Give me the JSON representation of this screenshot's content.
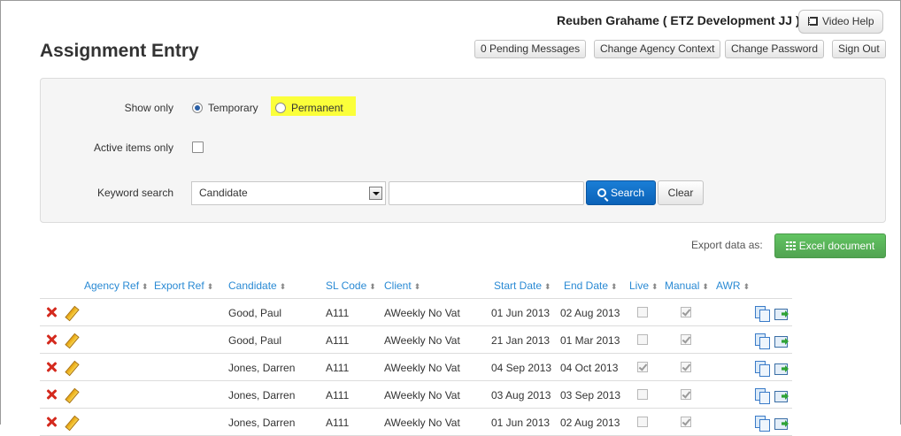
{
  "header": {
    "user_name": "Reuben Grahame ( ETZ Development JJ )",
    "video_help": "Video Help",
    "page_title": "Assignment Entry",
    "links": [
      "0 Pending Messages",
      "Change Agency Context",
      "Change Password",
      "Sign Out"
    ]
  },
  "filters": {
    "show_only_label": "Show only",
    "temporary_label": "Temporary",
    "permanent_label": "Permanent",
    "selected": "Temporary",
    "active_label": "Active items only",
    "active_checked": false,
    "keyword_label": "Keyword search",
    "keyword_field": "Candidate",
    "keyword_value": "",
    "search_label": "Search",
    "clear_label": "Clear"
  },
  "export": {
    "label": "Export data as:",
    "excel_label": "Excel document"
  },
  "table": {
    "columns": [
      "Agency Ref",
      "Export Ref",
      "Candidate",
      "SL Code",
      "Client",
      "Start Date",
      "End Date",
      "Live",
      "Manual",
      "AWR"
    ],
    "rows": [
      {
        "candidate": "Good, Paul",
        "sl_code": "A111",
        "client": "AWeekly No Vat",
        "start": "01 Jun 2013",
        "end": "02 Aug 2013",
        "live": false,
        "manual": true
      },
      {
        "candidate": "Good, Paul",
        "sl_code": "A111",
        "client": "AWeekly No Vat",
        "start": "21 Jan 2013",
        "end": "01 Mar 2013",
        "live": false,
        "manual": true
      },
      {
        "candidate": "Jones, Darren",
        "sl_code": "A111",
        "client": "AWeekly No Vat",
        "start": "04 Sep 2013",
        "end": "04 Oct 2013",
        "live": true,
        "manual": true
      },
      {
        "candidate": "Jones, Darren",
        "sl_code": "A111",
        "client": "AWeekly No Vat",
        "start": "03 Aug 2013",
        "end": "03 Sep 2013",
        "live": false,
        "manual": true
      },
      {
        "candidate": "Jones, Darren",
        "sl_code": "A111",
        "client": "AWeekly No Vat",
        "start": "01 Jun 2013",
        "end": "02 Aug 2013",
        "live": false,
        "manual": true
      }
    ]
  },
  "colors": {
    "accent_blue": "#0b62b8",
    "link_blue": "#2a8ad4",
    "excel_green": "#51a351",
    "highlight_yellow": "#fbff3a",
    "delete_red": "#d42a1e"
  }
}
